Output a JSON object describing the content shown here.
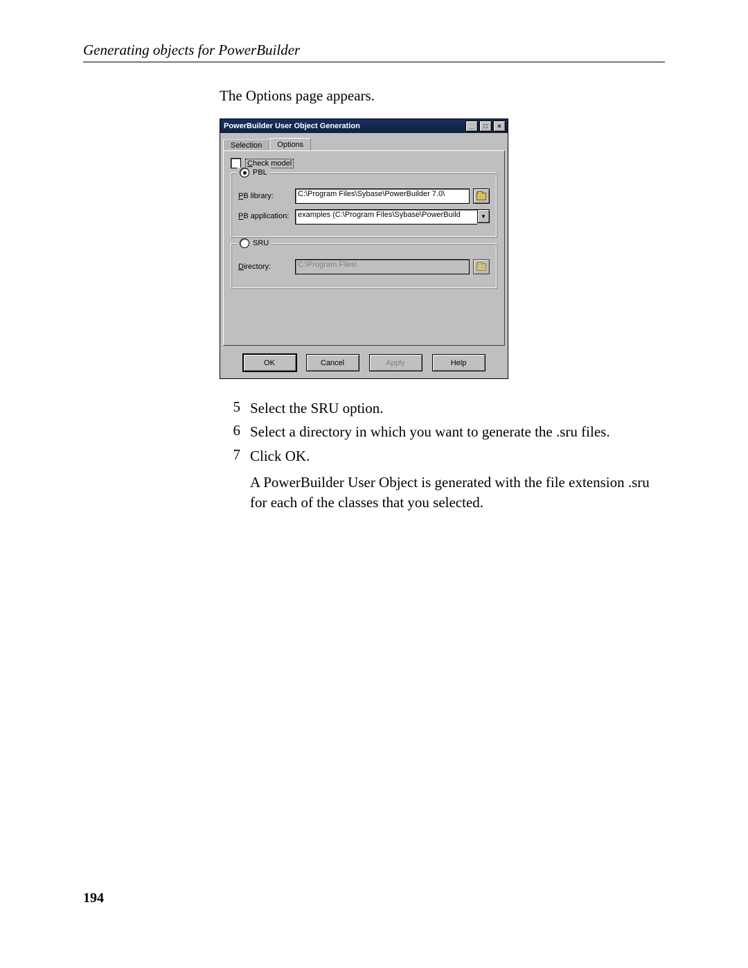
{
  "header": "Generating objects for PowerBuilder",
  "intro": "The Options page appears.",
  "dialog": {
    "title": "PowerBuilder User Object Generation",
    "tabs": {
      "selection": "Selection",
      "options": "Options"
    },
    "check_model": "Check model",
    "pbl": {
      "label": "PBL",
      "lib_label": "PB library:",
      "lib_value": "C:\\Program Files\\Sybase\\PowerBuilder 7.0\\",
      "app_label": "PB application:",
      "app_value": "examples (C:\\Program Files\\Sybase\\PowerBuild"
    },
    "sru": {
      "label": "SRU",
      "dir_label": "Directory:",
      "dir_value": "C:\\Program Files\\"
    },
    "buttons": {
      "ok": "OK",
      "cancel": "Cancel",
      "apply": "Apply",
      "help": "Help"
    }
  },
  "steps": [
    {
      "n": "5",
      "t": "Select the SRU option."
    },
    {
      "n": "6",
      "t": "Select a directory in which you want to generate the .sru files."
    },
    {
      "n": "7",
      "t": "Click OK."
    }
  ],
  "follow": "A PowerBuilder User Object is generated with the file extension .sru for each of the classes that you selected.",
  "page_number": "194"
}
